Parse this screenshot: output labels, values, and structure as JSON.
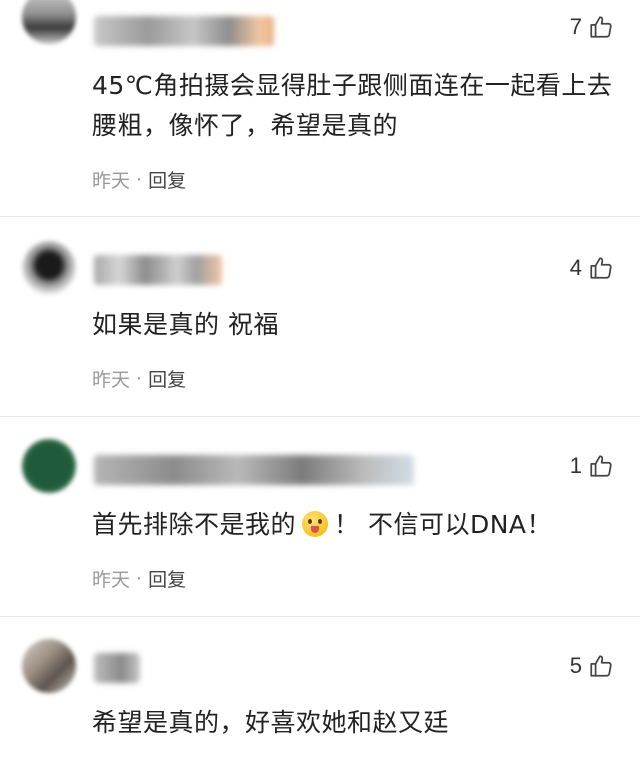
{
  "comments": [
    {
      "likes": "7",
      "text": "45℃角拍摄会显得肚子跟侧面连在一起看上去腰粗，像怀了，希望是真的",
      "time": "昨天",
      "dot": "·",
      "reply": "回复"
    },
    {
      "likes": "4",
      "text": "如果是真的 祝福",
      "time": "昨天",
      "dot": "·",
      "reply": "回复"
    },
    {
      "likes": "1",
      "text_before": "首先排除不是我的",
      "text_after": "！ 不信可以DNA！",
      "time": "昨天",
      "dot": "·",
      "reply": "回复"
    },
    {
      "likes": "5",
      "text": "希望是真的，好喜欢她和赵又廷"
    }
  ],
  "icons": {
    "like": "thumbs-up-icon",
    "emoji": "tongue-out-emoji-icon"
  },
  "colors": {
    "text": "#222222",
    "meta": "#999999",
    "divider": "#e4e4e4"
  }
}
